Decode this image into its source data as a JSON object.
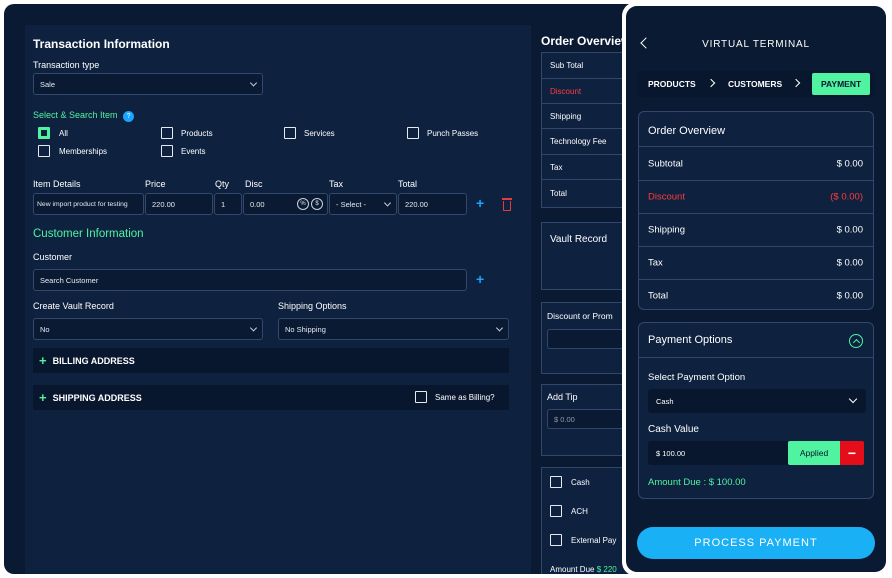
{
  "transaction": {
    "title": "Transaction Information",
    "type_label": "Transaction type",
    "type_value": "Sale",
    "select_search_label": "Select & Search Item",
    "info_icon": "info-icon",
    "checkboxes": [
      {
        "label": "All",
        "checked": true
      },
      {
        "label": "Products",
        "checked": false
      },
      {
        "label": "Services",
        "checked": false
      },
      {
        "label": "Punch Passes",
        "checked": false
      },
      {
        "label": "Memberships",
        "checked": false
      },
      {
        "label": "Events",
        "checked": false
      }
    ],
    "item_headers": [
      "Item Details",
      "Price",
      "Qty",
      "Disc",
      "Tax",
      "Total"
    ],
    "item_row": {
      "details": "New import product for testing",
      "price": "220.00",
      "qty": "1",
      "disc": "0.00",
      "disc_pct": "%",
      "disc_dollar": "$",
      "tax": "- Select -",
      "total": "220.00"
    }
  },
  "customer": {
    "title": "Customer Information",
    "customer_label": "Customer",
    "search_placeholder": "Search Customer",
    "vault_label": "Create Vault Record",
    "vault_value": "No",
    "shipping_label": "Shipping Options",
    "shipping_value": "No Shipping",
    "billing_address": "BILLING ADDRESS",
    "shipping_address": "SHIPPING ADDRESS",
    "same_as_billing": "Same as Billing?"
  },
  "order_overview_bg": {
    "title": "Order Overview",
    "rows": [
      "Sub Total",
      "Discount",
      "Shipping",
      "Technology Fee",
      "Tax",
      "Total"
    ],
    "vault_record": "Vault Record",
    "discount_promo": "Discount or Prom",
    "add_tip": "Add Tip",
    "tip_placeholder": "$ 0.00",
    "pay_methods": [
      "Cash",
      "ACH",
      "External Pay"
    ],
    "amount_due_label": "Amount Due",
    "amount_due_value": "$ 220"
  },
  "terminal": {
    "title": "VIRTUAL TERMINAL",
    "steps": [
      "PRODUCTS",
      "CUSTOMERS",
      "PAYMENT"
    ],
    "order_overview": {
      "title": "Order Overview",
      "rows": [
        {
          "label": "Subtotal",
          "value": "$ 0.00"
        },
        {
          "label": "Discount",
          "value": "($ 0.00)"
        },
        {
          "label": "Shipping",
          "value": "$ 0.00"
        },
        {
          "label": "Tax",
          "value": "$ 0.00"
        },
        {
          "label": "Total",
          "value": "$ 0.00"
        }
      ]
    },
    "payment_options": {
      "title": "Payment Options",
      "select_label": "Select Payment Option",
      "select_value": "Cash",
      "cash_label": "Cash Value",
      "cash_value": "$ 100.00",
      "applied": "Applied",
      "minus": "−",
      "amount_due": "Amount Due : $ 100.00"
    },
    "process_button": "PROCESS PAYMENT"
  },
  "colors": {
    "accent_green": "#4ff3a0",
    "accent_blue": "#1ab0f5",
    "danger": "#e30e1a",
    "background": "#0a1a33"
  }
}
